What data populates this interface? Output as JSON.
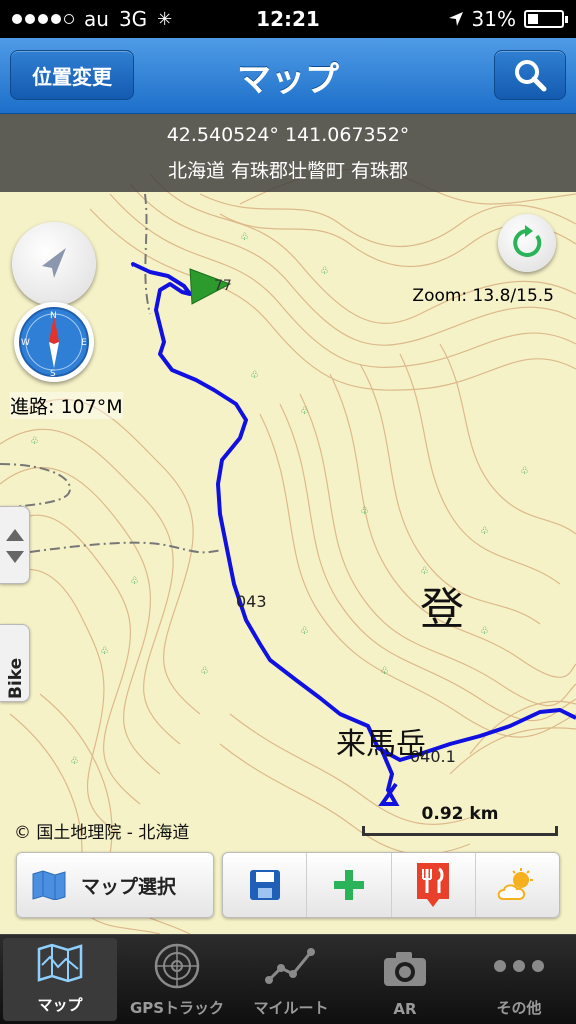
{
  "status": {
    "carrier": "au",
    "network": "3G",
    "time": "12:21",
    "battery": "31%",
    "battery_level": 0.31
  },
  "nav": {
    "title": "マップ",
    "left_button": "位置変更",
    "right_icon": "search-icon"
  },
  "map": {
    "coordinates": "42.540524° 141.067352°",
    "address": "北海道 有珠郡壮瞥町 有珠郡",
    "zoom": "Zoom: 13.8/15.5",
    "heading": "進路: 107°M",
    "side_tab_label": "Bike",
    "copyright": "© 国土地理院 - 北海道",
    "scale": "0.92 km",
    "labels": {
      "elev_043": "043",
      "elev_0401": "040.1",
      "elev_77": "77",
      "big_kanji": "登",
      "peak_name": "来馬岳"
    },
    "map_select": "マップ選択"
  },
  "colors": {
    "track": "#1010e0",
    "accent": "#1d6fc9",
    "toolbar_plus": "#2bb35a",
    "toolbar_food": "#e8402a"
  },
  "tabs": [
    {
      "label": "マップ",
      "icon": "map-icon",
      "active": true
    },
    {
      "label": "GPSトラック",
      "icon": "radar-icon",
      "active": false
    },
    {
      "label": "マイルート",
      "icon": "route-icon",
      "active": false
    },
    {
      "label": "AR",
      "icon": "camera-icon",
      "active": false
    },
    {
      "label": "その他",
      "icon": "more-icon",
      "active": false
    }
  ]
}
